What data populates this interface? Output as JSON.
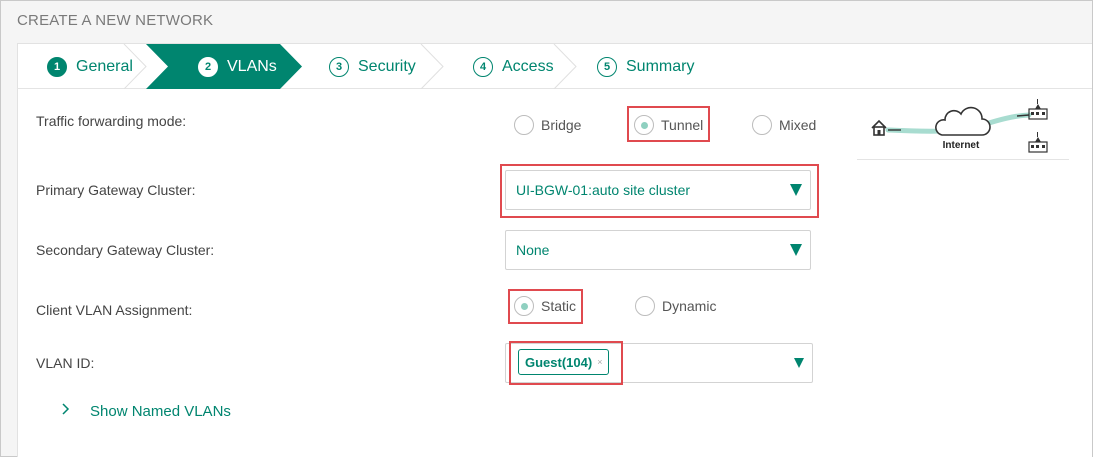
{
  "page": {
    "title": "CREATE A NEW NETWORK"
  },
  "wizard": {
    "steps": [
      {
        "num": "1",
        "label": "General",
        "state": "done"
      },
      {
        "num": "2",
        "label": "VLANs",
        "state": "active"
      },
      {
        "num": "3",
        "label": "Security",
        "state": "pending"
      },
      {
        "num": "4",
        "label": "Access",
        "state": "pending"
      },
      {
        "num": "5",
        "label": "Summary",
        "state": "pending"
      }
    ]
  },
  "form": {
    "traffic_mode": {
      "label": "Traffic forwarding mode:",
      "options": [
        "Bridge",
        "Tunnel",
        "Mixed"
      ],
      "selected": "Tunnel"
    },
    "primary_gateway": {
      "label": "Primary Gateway Cluster:",
      "value": "UI-BGW-01:auto site cluster"
    },
    "secondary_gateway": {
      "label": "Secondary Gateway Cluster:",
      "value": "None"
    },
    "client_vlan": {
      "label": "Client VLAN Assignment:",
      "options": [
        "Static",
        "Dynamic"
      ],
      "selected": "Static"
    },
    "vlan_id": {
      "label": "VLAN ID:",
      "tag": "Guest(104)",
      "remove_glyph": "×"
    },
    "show_named_vlans": "Show Named VLANs"
  },
  "diagram": {
    "internet_label": "Internet"
  },
  "colors": {
    "accent": "#00856f",
    "highlight": "#e04a4f",
    "radio_dot": "#8fd0c0",
    "tunnel": "#a8dcd0"
  }
}
